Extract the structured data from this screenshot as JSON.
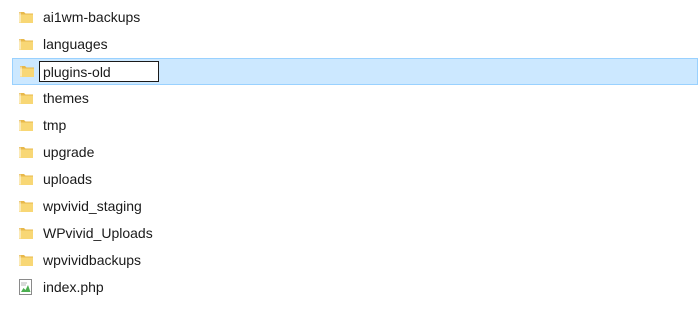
{
  "files": [
    {
      "name": "ai1wm-backups",
      "type": "folder",
      "icon": "folder-icon"
    },
    {
      "name": "languages",
      "type": "folder",
      "icon": "folder-icon"
    },
    {
      "name": "plugins-old",
      "type": "folder",
      "icon": "folder-icon",
      "selected": true,
      "renaming": true
    },
    {
      "name": "themes",
      "type": "folder",
      "icon": "folder-icon"
    },
    {
      "name": "tmp",
      "type": "folder",
      "icon": "folder-icon"
    },
    {
      "name": "upgrade",
      "type": "folder",
      "icon": "folder-icon"
    },
    {
      "name": "uploads",
      "type": "folder",
      "icon": "folder-icon"
    },
    {
      "name": "wpvivid_staging",
      "type": "folder",
      "icon": "folder-icon"
    },
    {
      "name": "WPvivid_Uploads",
      "type": "folder",
      "icon": "folder-icon"
    },
    {
      "name": "wpvividbackups",
      "type": "folder",
      "icon": "folder-icon"
    },
    {
      "name": "index.php",
      "type": "file",
      "icon": "php-file-icon"
    }
  ],
  "colors": {
    "selection_bg": "#cce8ff",
    "selection_border": "#99d1ff",
    "folder_yellow": "#f8d775"
  }
}
